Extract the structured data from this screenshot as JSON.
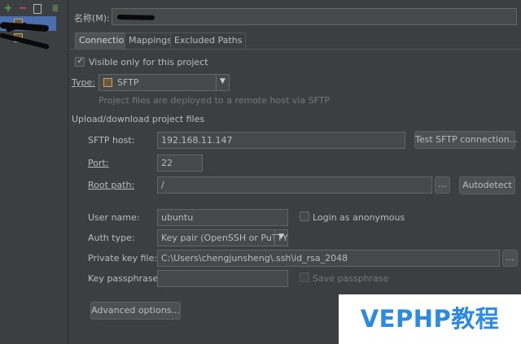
{
  "name_field": {
    "label": "名称(M):",
    "value": ""
  },
  "tabs": [
    {
      "label": "Connection",
      "active": true
    },
    {
      "label": "Mappings",
      "active": false
    },
    {
      "label": "Excluded Paths",
      "active": false
    }
  ],
  "visible_only": {
    "label": "Visible only for this project",
    "checked": true
  },
  "type": {
    "label": "Type:",
    "value": "SFTP",
    "hint": "Project files are deployed to a remote host via SFTP"
  },
  "section_title": "Upload/download project files",
  "sftp_host": {
    "label": "SFTP host:",
    "value": "192.168.11.147",
    "test_button": "Test SFTP connection..."
  },
  "port": {
    "label": "Port:",
    "value": "22"
  },
  "root_path": {
    "label": "Root path:",
    "value": "/",
    "browse": "...",
    "autodetect": "Autodetect"
  },
  "user_name": {
    "label": "User name:",
    "value": "ubuntu",
    "anon_label": "Login as anonymous",
    "anon_checked": false
  },
  "auth_type": {
    "label": "Auth type:",
    "value": "Key pair (OpenSSH or PuTTY)"
  },
  "private_key": {
    "label": "Private key file:",
    "value": "C:\\Users\\chengjunsheng\\.ssh\\id_rsa_2048",
    "browse": "..."
  },
  "passphrase": {
    "label": "Key passphrase:",
    "value": "",
    "save_label": "Save passphrase",
    "save_checked": false
  },
  "advanced_button": "Advanced options...",
  "watermark": "VEPHP教程",
  "colors": {
    "background": "#3c3f41",
    "selection": "#4b6eaf",
    "field": "#45494a",
    "add": "#57a64a",
    "remove": "#c75450",
    "watermark_text": "#2a8be0"
  }
}
